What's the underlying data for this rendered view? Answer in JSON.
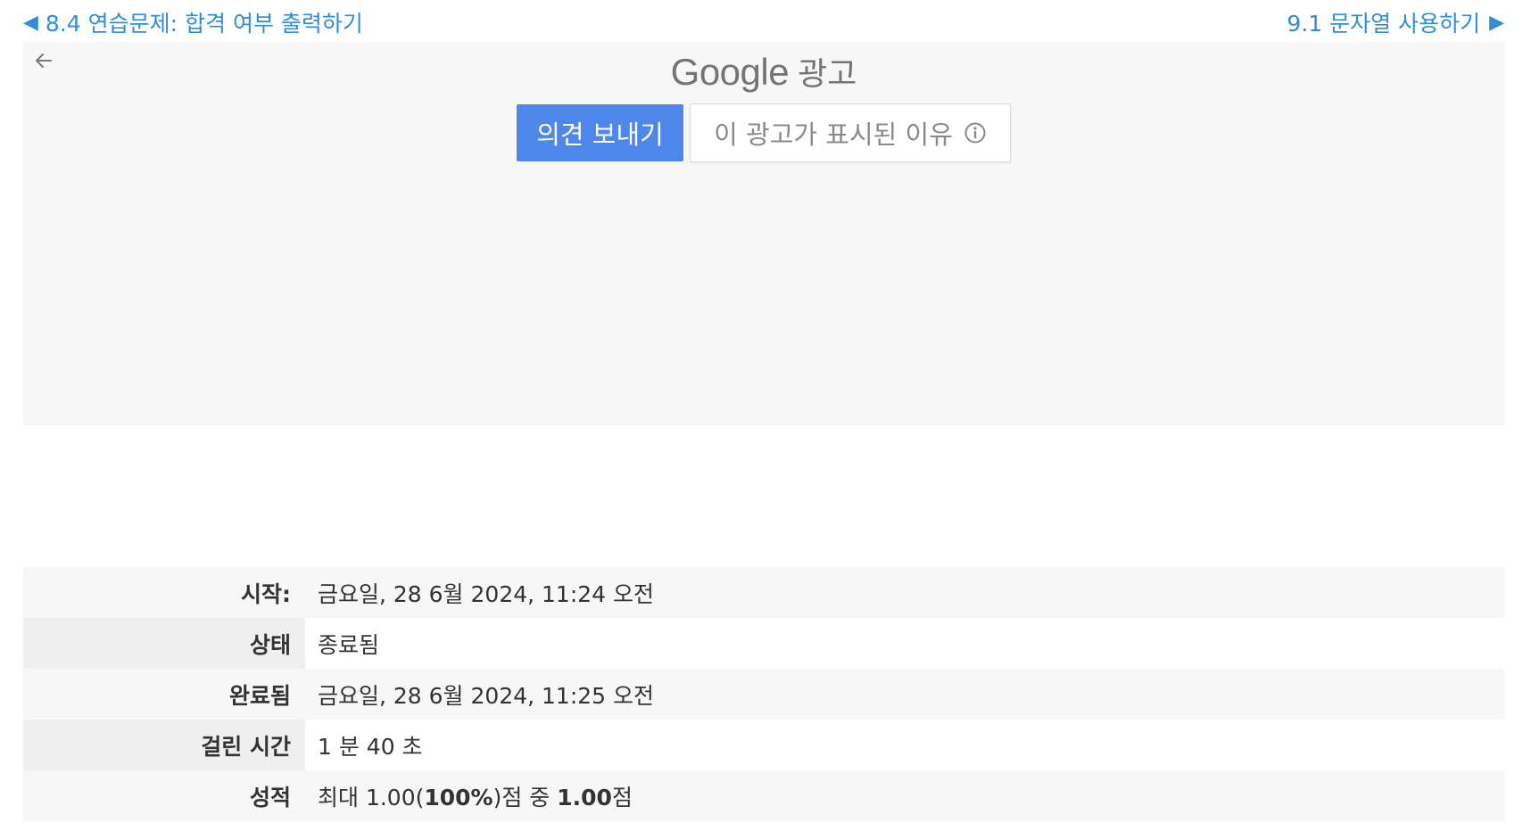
{
  "nav": {
    "prev_label": "8.4 연습문제: 합격 여부 출력하기",
    "next_label": "9.1 문자열 사용하기"
  },
  "ad": {
    "brand": "Google",
    "brand_suffix": "광고",
    "feedback_button": "의견 보내기",
    "why_button": "이 광고가 표시된 이유"
  },
  "summary": {
    "rows": [
      {
        "label": "시작:",
        "value": "금요일, 28 6월 2024, 11:24 오전"
      },
      {
        "label": "상태",
        "value": "종료됨"
      },
      {
        "label": "완료됨",
        "value": "금요일, 28 6월 2024, 11:25 오전"
      },
      {
        "label": "걸린 시간",
        "value": "1 분 40 초"
      },
      {
        "label": "성적",
        "value": ""
      }
    ],
    "grade": {
      "prefix": "최대 1.00(",
      "percent": "100%",
      "mid": ")점 중 ",
      "score": "1.00",
      "suffix": "점"
    }
  },
  "colors": {
    "link": "#2f8ed6",
    "feedback_button_bg": "#4f86ec",
    "ad_background": "#f7f7f7"
  },
  "icons": {
    "prev": "triangle-left",
    "next": "triangle-right",
    "back": "arrow-left",
    "info": "info-circle"
  }
}
